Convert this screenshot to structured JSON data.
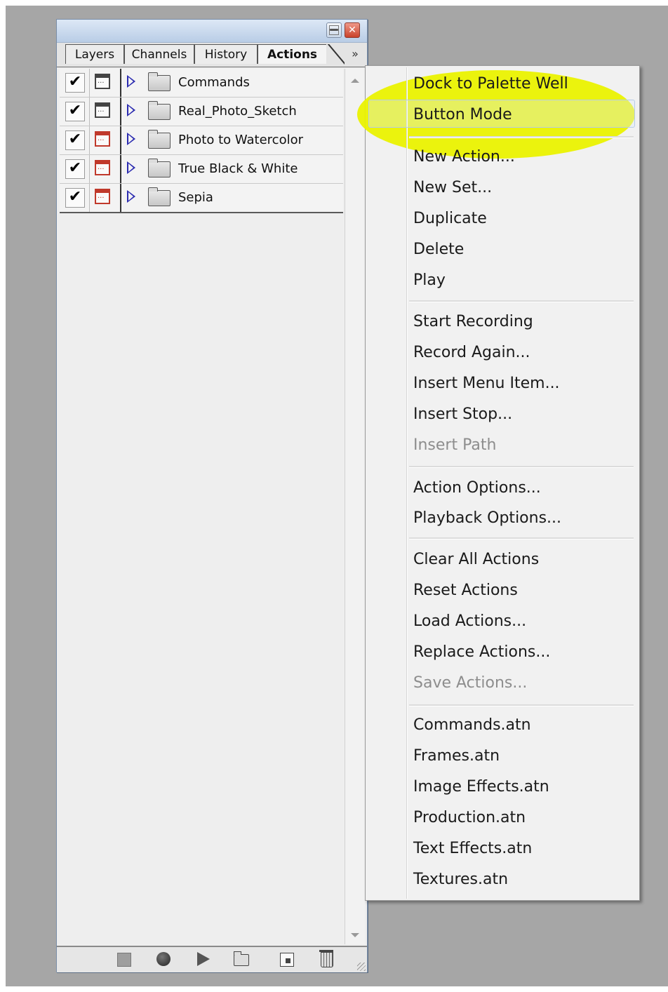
{
  "panel": {
    "tabs": [
      {
        "label": "Layers"
      },
      {
        "label": "Channels"
      },
      {
        "label": "History"
      },
      {
        "label": "Actions",
        "active": true
      }
    ],
    "menu_button": "»",
    "close_glyph": "✕",
    "actions": [
      {
        "checked": true,
        "dialog_icon": "dialog-toggle-icon",
        "label": "Commands"
      },
      {
        "checked": true,
        "dialog_icon": "dialog-toggle-icon",
        "label": "Real_Photo_Sketch"
      },
      {
        "checked": true,
        "dialog_icon": "dialog-toggle-icon-red",
        "label": "Photo to Watercolor"
      },
      {
        "checked": true,
        "dialog_icon": "dialog-toggle-icon-red",
        "label": "True Black & White"
      },
      {
        "checked": true,
        "dialog_icon": "dialog-toggle-icon-red",
        "label": "Sepia"
      }
    ],
    "check_glyph": "✔"
  },
  "menu": {
    "highlight_color": "#eaf200",
    "items": [
      {
        "label": "Dock to Palette Well",
        "enabled": true
      },
      {
        "label": "Button Mode",
        "enabled": true,
        "hover": true
      },
      {
        "separator": true
      },
      {
        "label": "New Action...",
        "enabled": true
      },
      {
        "label": "New Set...",
        "enabled": true
      },
      {
        "label": "Duplicate",
        "enabled": true
      },
      {
        "label": "Delete",
        "enabled": true
      },
      {
        "label": "Play",
        "enabled": true
      },
      {
        "separator": true
      },
      {
        "label": "Start Recording",
        "enabled": true
      },
      {
        "label": "Record Again...",
        "enabled": true
      },
      {
        "label": "Insert Menu Item...",
        "enabled": true
      },
      {
        "label": "Insert Stop...",
        "enabled": true
      },
      {
        "label": "Insert Path",
        "enabled": false
      },
      {
        "separator": true
      },
      {
        "label": "Action Options...",
        "enabled": true
      },
      {
        "label": "Playback Options...",
        "enabled": true
      },
      {
        "separator": true
      },
      {
        "label": "Clear All Actions",
        "enabled": true
      },
      {
        "label": "Reset Actions",
        "enabled": true
      },
      {
        "label": "Load Actions...",
        "enabled": true
      },
      {
        "label": "Replace Actions...",
        "enabled": true
      },
      {
        "label": "Save Actions...",
        "enabled": false
      },
      {
        "separator": true
      },
      {
        "label": "Commands.atn",
        "enabled": true
      },
      {
        "label": "Frames.atn",
        "enabled": true
      },
      {
        "label": "Image Effects.atn",
        "enabled": true
      },
      {
        "label": "Production.atn",
        "enabled": true
      },
      {
        "label": "Text Effects.atn",
        "enabled": true
      },
      {
        "label": "Textures.atn",
        "enabled": true
      }
    ]
  },
  "bottom_toolbar": {
    "buttons": [
      "stop-icon",
      "record-icon",
      "play-icon",
      "new-set-icon",
      "new-action-icon",
      "trash-icon"
    ]
  }
}
